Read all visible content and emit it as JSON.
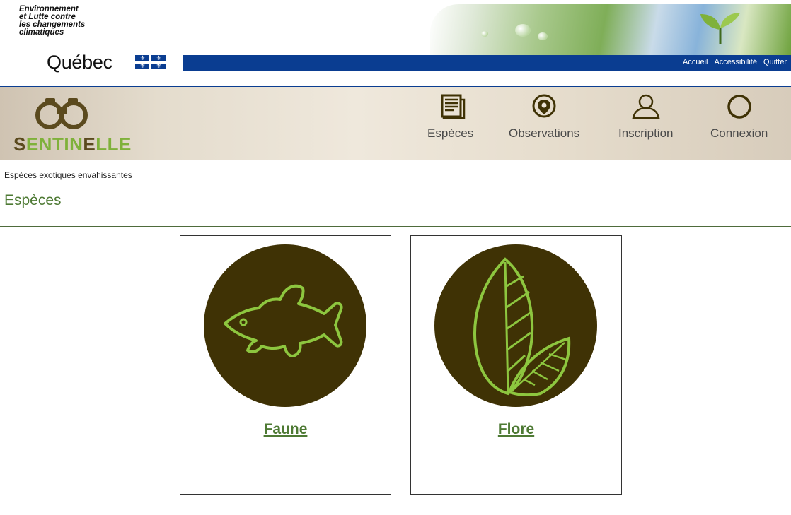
{
  "gov": {
    "ministry_lines": [
      "Environnement",
      "et Lutte contre",
      "les changements",
      "climatiques"
    ],
    "quebec": "Québec",
    "links": [
      "Accueil",
      "Accessibilité",
      "Quitter"
    ],
    "brand_blue": "#0a3d91"
  },
  "app": {
    "logo_part1": "S",
    "logo_part2": "ENTIN",
    "logo_part3": "E",
    "logo_part4": "LLE",
    "nav": [
      {
        "label": "Espèces",
        "icon": "book-icon"
      },
      {
        "label": "Observations",
        "icon": "location-pin-icon"
      },
      {
        "label": "Inscription",
        "icon": "user-icon"
      },
      {
        "label": "Connexion",
        "icon": "circle-icon"
      }
    ]
  },
  "page": {
    "breadcrumb": "Espèces exotiques envahissantes",
    "title": "Espèces",
    "accent_green": "#4e7a34",
    "circle_brown": "#3f3205"
  },
  "cards": [
    {
      "label": "Faune",
      "icon": "fish-icon"
    },
    {
      "label": "Flore",
      "icon": "leaf-icon"
    }
  ]
}
